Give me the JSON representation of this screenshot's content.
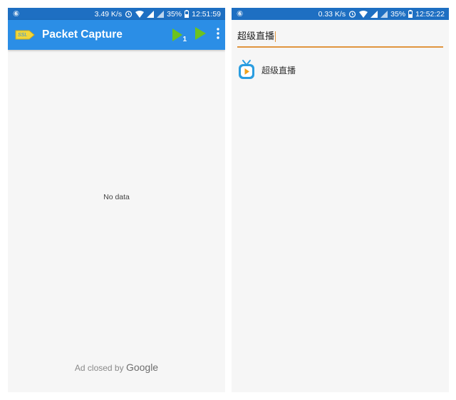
{
  "left_screen": {
    "status_bar": {
      "logo": "⑥",
      "speed": "3.49 K/s",
      "battery": "35%",
      "time": "12:51:59"
    },
    "app_bar": {
      "title": "Packet Capture",
      "action_1_badge": "1",
      "icons": [
        "ssl-logo-icon",
        "play-with-app-icon",
        "play-icon",
        "overflow-menu-icon"
      ]
    },
    "empty_message": "No data",
    "ad": {
      "prefix": "Ad closed by",
      "brand": "Google"
    }
  },
  "right_screen": {
    "status_bar": {
      "logo": "⑥",
      "speed": "0.33 K/s",
      "battery": "35%",
      "time": "12:52:22"
    },
    "search": {
      "value": "超级直播"
    },
    "results": [
      {
        "label": "超级直播",
        "icon": "tv-app-icon"
      }
    ]
  },
  "colors": {
    "status_bar": "#1e6fc2",
    "app_bar": "#2b8ee6",
    "play_green": "#6cc21e",
    "search_underline": "#e0953e",
    "background": "#f6f6f6"
  }
}
